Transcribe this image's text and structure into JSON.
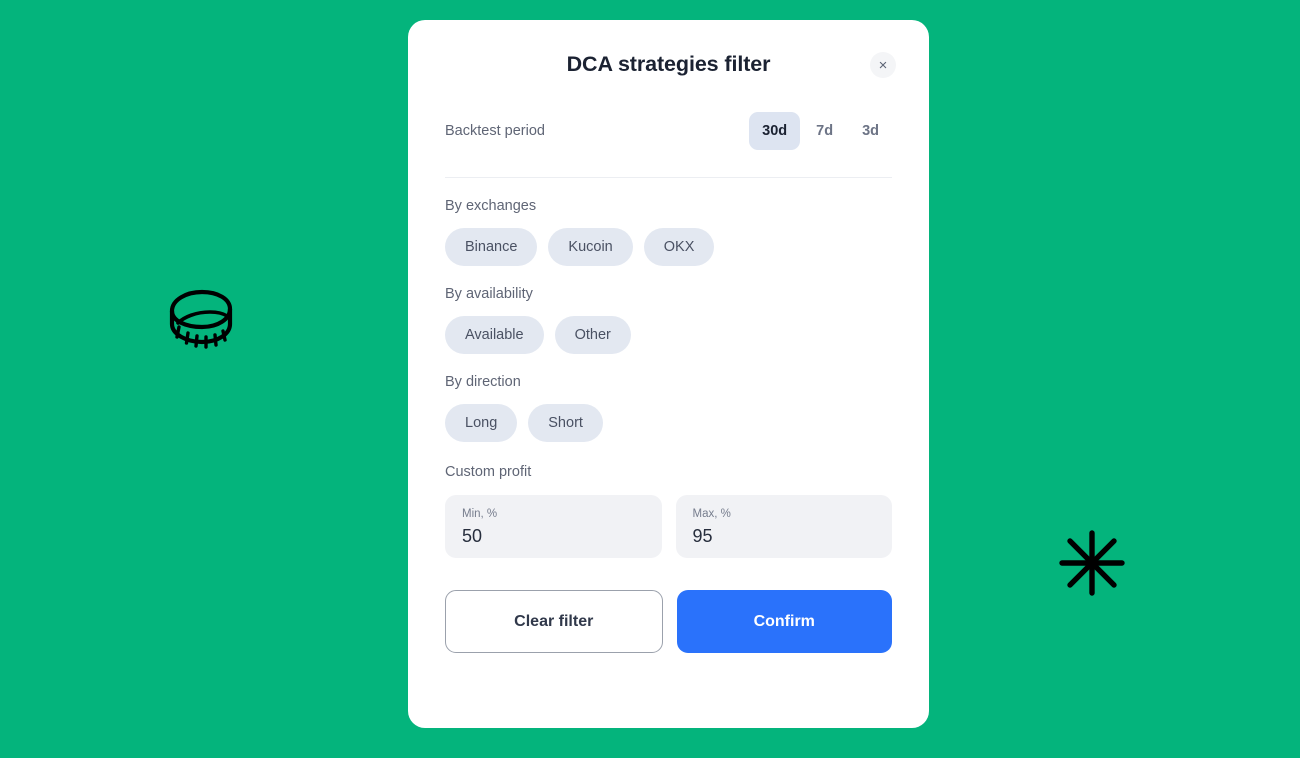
{
  "background": {
    "color": "#04b47c"
  },
  "decorations": [
    {
      "name": "coin-icon",
      "label": "coin"
    },
    {
      "name": "sparkle-icon",
      "label": "asterisk"
    }
  ],
  "modal": {
    "title": "DCA strategies filter",
    "close_label": "×",
    "backtest": {
      "label": "Backtest period",
      "options": [
        {
          "label": "30d",
          "active": true
        },
        {
          "label": "7d",
          "active": false
        },
        {
          "label": "3d",
          "active": false
        }
      ]
    },
    "sections": [
      {
        "name": "exchanges",
        "label": "By exchanges",
        "chips": [
          "Binance",
          "Kucoin",
          "OKX"
        ]
      },
      {
        "name": "availability",
        "label": "By availability",
        "chips": [
          "Available",
          "Other"
        ]
      },
      {
        "name": "direction",
        "label": "By direction",
        "chips": [
          "Long",
          "Short"
        ]
      }
    ],
    "custom_profit": {
      "label": "Custom profit",
      "min": {
        "label": "Min, %",
        "value": "50",
        "placeholder": "Min, %"
      },
      "max": {
        "label": "Max, %",
        "value": "95",
        "placeholder": "Max, %"
      }
    },
    "actions": {
      "clear_label": "Clear filter",
      "confirm_label": "Confirm",
      "confirm_color": "#2a72fb"
    }
  }
}
